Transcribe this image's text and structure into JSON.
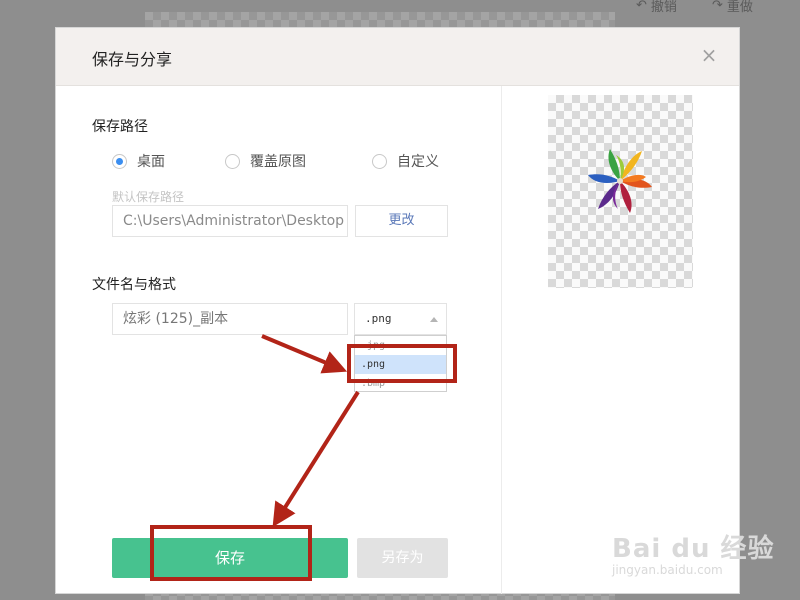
{
  "topbar": {
    "undo_label": "撤销",
    "redo_label": "重做"
  },
  "dialog": {
    "title": "保存与分享",
    "close_icon": "close-icon",
    "save_path": {
      "label": "保存路径",
      "options": [
        {
          "label": "桌面",
          "selected": true
        },
        {
          "label": "覆盖原图",
          "selected": false
        },
        {
          "label": "自定义",
          "selected": false
        }
      ],
      "hint": "默认保存路径",
      "path_value": "C:\\Users\\Administrator\\Desktop",
      "change_label": "更改"
    },
    "file": {
      "label": "文件名与格式",
      "name_value": "炫彩 (125)_副本",
      "format_selected": ".png",
      "format_options": [
        ".jpg",
        ".png",
        ".bmp"
      ]
    },
    "buttons": {
      "save": "保存",
      "save_as": "另存为"
    }
  },
  "annotation": {
    "color": "#b22418"
  },
  "watermark": {
    "logo": "Bai du 经验",
    "url": "jingyan.baidu.com"
  },
  "colors": {
    "primary": "#47c28f",
    "radio_active": "#3b8ef0",
    "selection": "#cfe3fb"
  }
}
